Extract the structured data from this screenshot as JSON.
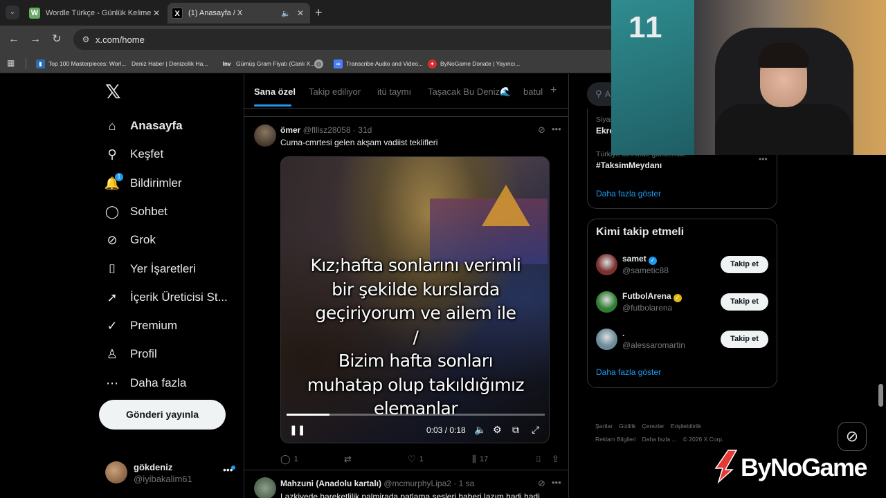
{
  "browser": {
    "tabs": [
      {
        "favicon": "W",
        "title": "Wordle Türkçe - Günlük Kelime Oyunu"
      },
      {
        "favicon": "X",
        "title": "(1) Anasayfa / X"
      }
    ],
    "url": "x.com/home",
    "bookmarks": [
      {
        "label": "Top 100 Masterpieces: Worl...",
        "icon": "book-icon"
      },
      {
        "label": "Deniz Haber | Denizcilik Ha...",
        "icon": "news-icon"
      },
      {
        "label": "Gümüş Gram Fiyatı (Canlı X...",
        "icon": "inv-icon",
        "favicon": "Inv"
      },
      {
        "label": "",
        "icon": "globe-icon"
      },
      {
        "label": "Transcribe Audio and Video...",
        "icon": "infinity-icon"
      },
      {
        "label": "ByNoGame Donate | Yayıncı...",
        "icon": "bynogame-icon"
      }
    ]
  },
  "sidebar": {
    "nav": [
      {
        "label": "Anasayfa",
        "icon": "home-icon",
        "glyph": "⌂",
        "active": true
      },
      {
        "label": "Keşfet",
        "icon": "search-icon",
        "glyph": "⚲"
      },
      {
        "label": "Bildirimler",
        "icon": "bell-icon",
        "glyph": "🔔",
        "badge": "1"
      },
      {
        "label": "Sohbet",
        "icon": "chat-icon",
        "glyph": "◯"
      },
      {
        "label": "Grok",
        "icon": "grok-icon",
        "glyph": "⊘"
      },
      {
        "label": "Yer İşaretleri",
        "icon": "bookmark-icon",
        "glyph": "⌷"
      },
      {
        "label": "İçerik Üreticisi St...",
        "icon": "rocket-icon",
        "glyph": "➚"
      },
      {
        "label": "Premium",
        "icon": "verified-icon",
        "glyph": "✓"
      },
      {
        "label": "Profil",
        "icon": "person-icon",
        "glyph": "♙"
      },
      {
        "label": "Daha fazla",
        "icon": "more-circle-icon",
        "glyph": "⋯"
      }
    ],
    "post_button": "Gönderi yayınla",
    "account": {
      "name": "gökdeniz",
      "handle": "@iyibakalim61"
    }
  },
  "feed": {
    "tabs": [
      "Sana özel",
      "Takip ediliyor",
      "itü taymı",
      "Taşacak Bu Deniz🌊",
      "batul"
    ],
    "tweet": {
      "name": "ömer",
      "handle": "@flllsz28058",
      "time": "31d",
      "text": "Cuma-cmrtesi gelen akşam vadiist teklifleri",
      "video": {
        "caption": [
          "Kız;hafta sonlarını verimli",
          "bir şekilde kurslarda",
          "geçiriyorum ve ailem ile",
          "/",
          "Bizim hafta sonları",
          "muhatap olup takıldığımız",
          "elemanlar"
        ],
        "time": "0:03 / 0:18",
        "progress": 0.167
      },
      "actions": {
        "replies": "1",
        "retweets": "",
        "likes": "1",
        "views": "17"
      }
    },
    "tweet2": {
      "name": "Mahzuni (Anadolu kartalı)",
      "handle": "@mcmurphyLipa2",
      "time": "1 sa",
      "text": "Lazkiyede hareketlilik palmirada patlama sesleri haberi lazım hadi hadi"
    }
  },
  "right": {
    "search_placeholder": "A",
    "trends": [
      {
        "category": "Siyas",
        "tag": "Ekre"
      },
      {
        "category": "Türkiye tarihinde gündemde",
        "tag": "#TaksimMeydanı"
      }
    ],
    "show_more": "Daha fazla göster",
    "who_to_follow": {
      "title": "Kimi takip etmeli",
      "users": [
        {
          "name": "samet",
          "handle": "@sametic88",
          "badge_color": "#1d9bf0",
          "avatar_color": "#7a3030"
        },
        {
          "name": "FutbolArena",
          "handle": "@futbolarena",
          "badge_color": "#e2b719",
          "avatar_color": "#2e7d32"
        },
        {
          "name": ".",
          "handle": "@alessaromartin",
          "badge_color": "",
          "avatar_color": "#6b8a9a"
        }
      ],
      "follow_label": "Takip et",
      "show_more": "Daha fazla göster"
    },
    "footer": [
      "Şartlar",
      "Gizlilik",
      "Çerezler",
      "Erişilebilirlik",
      "Reklam Bilgileri",
      "Daha fazla ...",
      "© 2026 X Corp."
    ]
  },
  "overlay": {
    "watermark": "ByNoGame",
    "jersey_number": "11"
  },
  "colors": {
    "accent": "#1d9bf0",
    "bg": "#000000",
    "border": "#2f3336",
    "muted": "#71767b"
  }
}
